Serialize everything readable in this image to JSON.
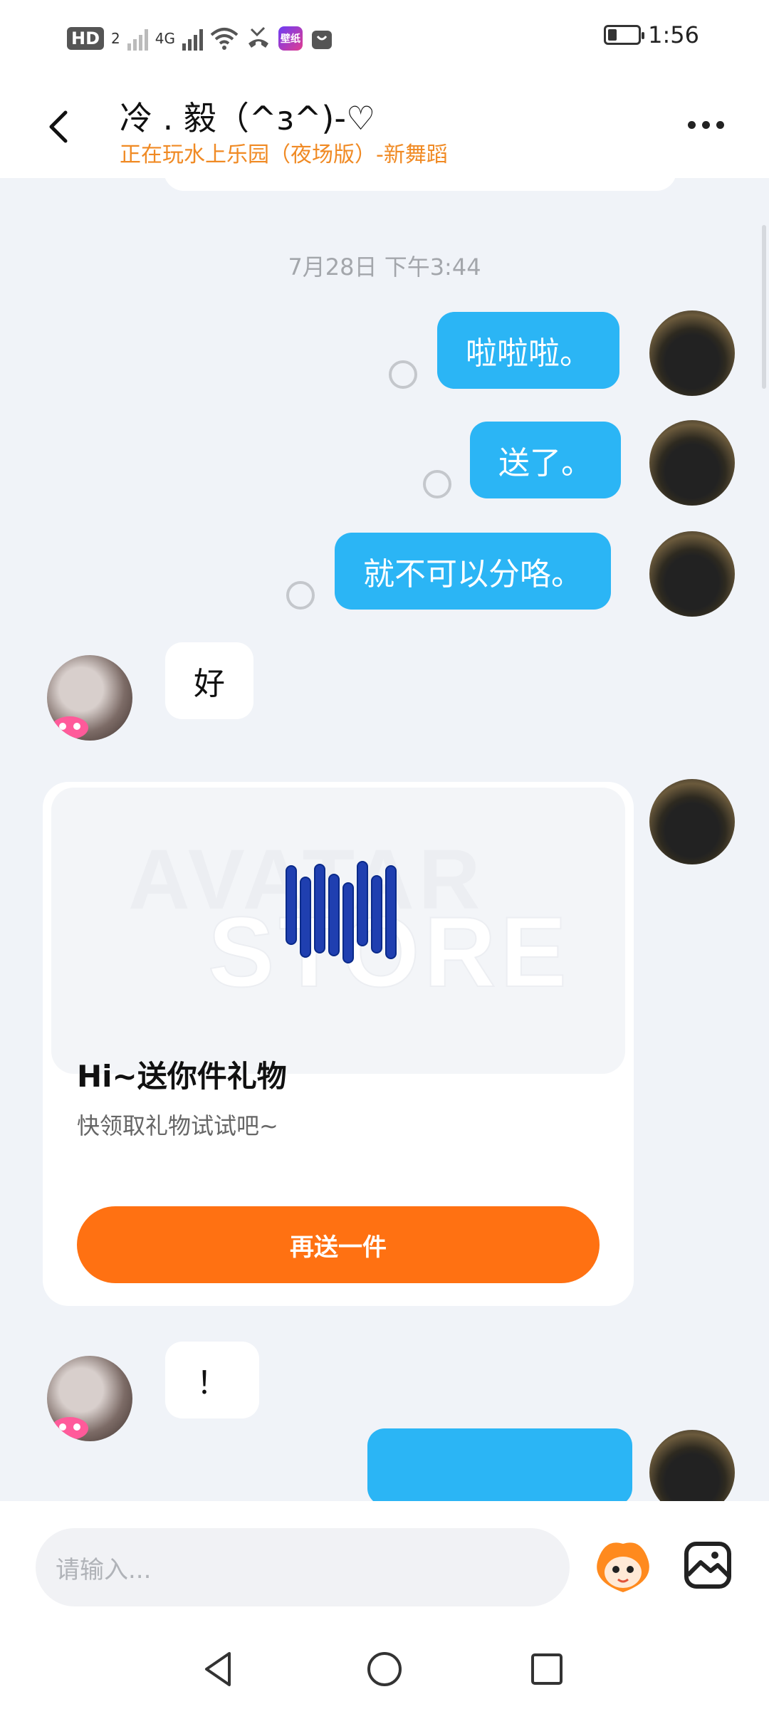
{
  "status_bar": {
    "hd_badge": "HD",
    "sim_number": "2",
    "network": "4G",
    "app_icon_label": "壁纸",
    "time": "1:56",
    "battery_level": 0.3
  },
  "header": {
    "title": "冷 . 毅（^з^)-♡",
    "subtitle": "正在玩水上乐园（夜场版）-新舞蹈"
  },
  "chat": {
    "timestamp": "7月28日 下午3:44",
    "messages": [
      {
        "from": "me",
        "text": "啦啦啦。"
      },
      {
        "from": "me",
        "text": "送了。"
      },
      {
        "from": "me",
        "text": "就不可以分咯。"
      },
      {
        "from": "other",
        "text": "好"
      },
      {
        "from": "other",
        "text": "！"
      }
    ],
    "gift_card": {
      "watermark_line1": "AVATAR",
      "watermark_line2": "STORE",
      "title": "Hi~送你件礼物",
      "description": "快领取礼物试试吧~",
      "button_label": "再送一件"
    }
  },
  "input_bar": {
    "placeholder": "请输入..."
  },
  "colors": {
    "my_bubble": "#2bb5f5",
    "accent_orange": "#ff7112",
    "subtitle_orange": "#f08a24",
    "background": "#f0f3f8"
  },
  "icons": [
    "back-arrow-icon",
    "more-dots-icon",
    "read-receipt-icon",
    "mascot-icon",
    "image-picker-icon",
    "nav-back-icon",
    "nav-home-icon",
    "nav-recents-icon"
  ]
}
